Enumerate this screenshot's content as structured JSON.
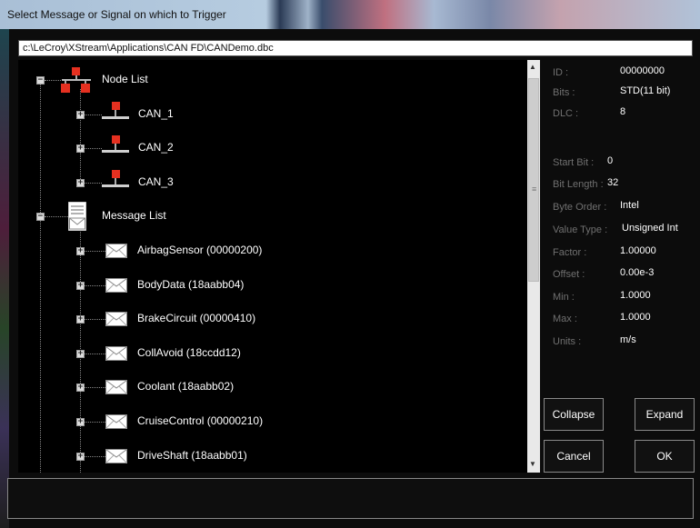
{
  "window": {
    "title": "Select Message or Signal on which to Trigger"
  },
  "path": "c:\\LeCroy\\XStream\\Applications\\CAN FD\\CANDemo.dbc",
  "tree": {
    "node_list": "Node List",
    "nodes": [
      "CAN_1",
      "CAN_2",
      "CAN_3"
    ],
    "message_list": "Message List",
    "messages": [
      "AirbagSensor (00000200)",
      "BodyData (18aabb04)",
      "BrakeCircuit (00000410)",
      "CollAvoid (18ccdd12)",
      "Coolant (18aabb02)",
      "CruiseControl (00000210)",
      "DriveShaft (18aabb01)"
    ]
  },
  "properties": [
    {
      "label": "ID :",
      "value": "00000000"
    },
    {
      "label": "Bits :",
      "value": "STD(11 bit)"
    },
    {
      "label": "DLC :",
      "value": "8"
    },
    {
      "label": "Start Bit :",
      "value": "0"
    },
    {
      "label": "Bit Length :",
      "value": "32"
    },
    {
      "label": "Byte Order :",
      "value": "Intel"
    },
    {
      "label": "Value Type :",
      "value": "Unsigned Int"
    },
    {
      "label": "Factor :",
      "value": "1.00000"
    },
    {
      "label": "Offset :",
      "value": "0.00e-3"
    },
    {
      "label": "Min :",
      "value": "1.0000"
    },
    {
      "label": "Max :",
      "value": "1.0000"
    },
    {
      "label": "Units :",
      "value": "m/s"
    }
  ],
  "buttons": {
    "collapse": "Collapse",
    "expand": "Expand",
    "cancel": "Cancel",
    "ok": "OK"
  },
  "expander_symbols": {
    "collapsed": "+",
    "expanded": "−"
  },
  "scroll_glyphs": {
    "up": "▲",
    "down": "▼",
    "grip": "≡"
  }
}
